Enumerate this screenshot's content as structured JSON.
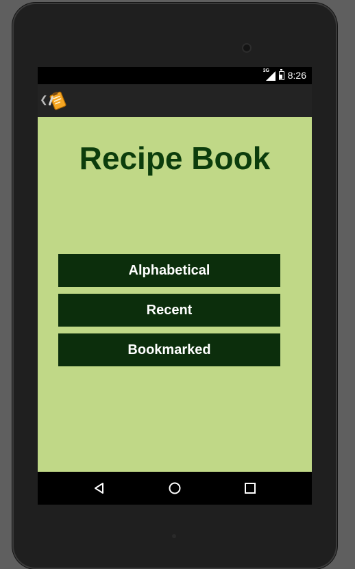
{
  "status_bar": {
    "network": "3G",
    "time": "8:26"
  },
  "action_bar": {
    "up_icon": "chevron-left-icon",
    "app_icon": "recipe-clipboard-icon"
  },
  "main": {
    "title": "Recipe Book",
    "buttons": [
      {
        "label": "Alphabetical"
      },
      {
        "label": "Recent"
      },
      {
        "label": "Bookmarked"
      }
    ]
  },
  "nav_bar": {
    "back_icon": "back-triangle-icon",
    "home_icon": "home-circle-icon",
    "recents_icon": "recents-square-icon"
  },
  "colors": {
    "background": "#c0d887",
    "title": "#0c3d0c",
    "button_bg": "#0c2e0c",
    "button_text": "#ffffff",
    "action_bar": "#232323"
  }
}
